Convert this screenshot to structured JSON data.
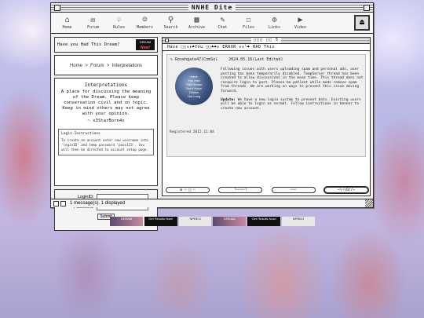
{
  "window": {
    "title": "NNHE Dite"
  },
  "toolbar": {
    "items": [
      {
        "label": "Home",
        "icon": "home-icon"
      },
      {
        "label": "Forum",
        "icon": "forum-icon"
      },
      {
        "label": "Rules",
        "icon": "rules-icon"
      },
      {
        "label": "Members",
        "icon": "members-icon"
      },
      {
        "label": "Search",
        "icon": "search-icon"
      },
      {
        "label": "Archive",
        "icon": "archive-icon"
      },
      {
        "label": "Chat",
        "icon": "chat-icon"
      },
      {
        "label": "Files",
        "icon": "files-icon"
      },
      {
        "label": "Links",
        "icon": "links-icon"
      },
      {
        "label": "Video",
        "icon": "video-icon"
      }
    ]
  },
  "promo": {
    "question": "Have you Had This Dream?",
    "badge_top": "DREAM",
    "badge_bottom": "Now!"
  },
  "breadcrumb": {
    "home": "Home",
    "forum": "Forum",
    "current": "Interpretations",
    "sep": ">"
  },
  "interpretations": {
    "title": "Interpretations",
    "description": "A place for discussing the meaning of the Dream. Please keep conversation civil and on topic. Keep in mind others may not agree with your opinion.",
    "signature": "~ x3StarBorn4x"
  },
  "login_instructions": {
    "title": "Login Instructions",
    "text": "To create an account enter new username into 'loginID' and temp password 'pass123'. You will then be directed to account setup page."
  },
  "login": {
    "id_label": "LoginID:",
    "password_label": "Password:",
    "submit_label": "Submit"
  },
  "thread": {
    "title": "□□□ □□ 5",
    "marquee": "Have □□⇟⇟♣You  □□♣♣⇟ ERROR  ⇟⇟╰♣ HAD This"
  },
  "post": {
    "author": "Rosehgate47(ComSo)",
    "date": "2024.05.16(Last Edited)",
    "avatar_lines": [
      "Have",
      "You Had",
      "This Dream",
      "Don't Have",
      "Dream",
      "Too Long"
    ],
    "registered": "Registered 2012.11.04",
    "body": "Following issues with users uploading spam and personal ads, user posting has been temporarily disabled. TempServer thread has been created to allow discussions in the mean time. This thread does not recquire login to post. Please be patient while mods remove spam from threads. We are working on ways to prevent this issue moving forward.",
    "update_label": "Update:",
    "update": "We have a new login system to prevent bots. Existing users will be able to login as normal. Follow instructions in banner to create new account."
  },
  "buttons": [
    {
      "label": "⊞ ⌒ □ ⌒"
    },
    {
      "label": "╰⌒⌒⌒⌒╰"
    },
    {
      "label": "⌒⌒⌒"
    },
    {
      "label": "~\\⌒\\O//~"
    }
  ],
  "status": {
    "text": "1 message(s), 1 displayed"
  },
  "banners": [
    {
      "text": "DREAM",
      "style": "a"
    },
    {
      "text": "Get Results Now!",
      "style": "b"
    },
    {
      "text": "NPREO",
      "style": "c"
    },
    {
      "text": "DREAM",
      "style": "a"
    },
    {
      "text": "Get Results Now!",
      "style": "b"
    },
    {
      "text": "NPREO",
      "style": "c"
    }
  ]
}
